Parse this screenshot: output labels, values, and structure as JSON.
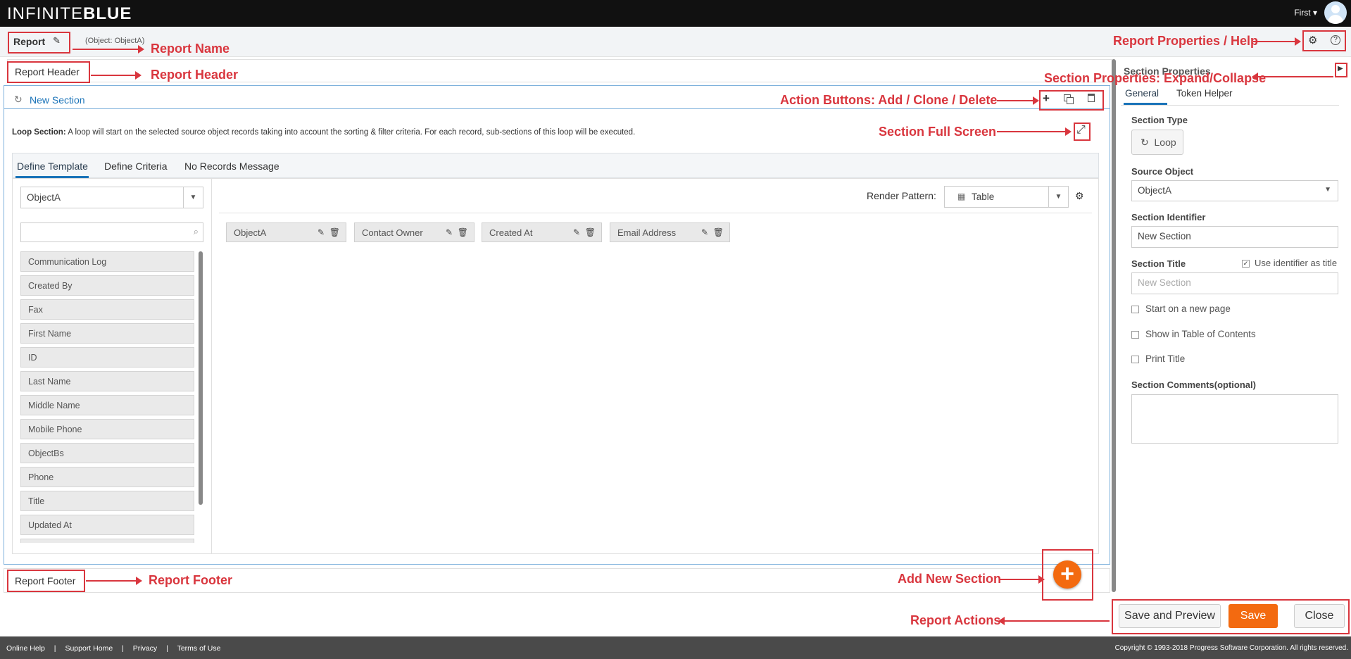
{
  "topbar": {
    "logo_left": "INFINITE",
    "logo_right": "BLUE",
    "user_name": "First ▾"
  },
  "header": {
    "report_title": "Report",
    "object_info": "(Object: ObjectA)"
  },
  "annotations": {
    "report_name": "Report Name",
    "report_header": "Report Header",
    "report_properties_help": "Report Properties / Help",
    "section_properties_expand": "Section Properties: Expand/Collapse",
    "action_buttons": "Action Buttons: Add / Clone / Delete",
    "section_full_screen": "Section Full Screen",
    "add_new_section": "Add New Section",
    "report_footer": "Report Footer",
    "report_actions": "Report Actions"
  },
  "canvas": {
    "report_header_label": "Report Header",
    "section_name": "New Section",
    "loop_prefix": "Loop Section:",
    "loop_description": " A loop will start on the selected source object records taking into account the sorting & filter criteria. For each record, sub-sections of this loop will be executed.",
    "tabs": [
      "Define Template",
      "Define Criteria",
      "No Records Message"
    ],
    "object_select": "ObjectA",
    "search_placeholder": "",
    "fields": [
      "Communication Log",
      "Created By",
      "Fax",
      "First Name",
      "ID",
      "Last Name",
      "Middle Name",
      "Mobile Phone",
      "ObjectBs",
      "Phone",
      "Title",
      "Updated At"
    ],
    "render_pattern_label": "Render Pattern:",
    "render_pattern_value": "Table",
    "columns": [
      "ObjectA",
      "Contact Owner",
      "Created At",
      "Email Address"
    ],
    "report_footer_label": "Report Footer"
  },
  "section_properties": {
    "title": "Section Properties",
    "tabs": [
      "General",
      "Token Helper"
    ],
    "section_type_label": "Section Type",
    "section_type_value": "Loop",
    "source_object_label": "Source Object",
    "source_object_value": "ObjectA",
    "section_identifier_label": "Section Identifier",
    "section_identifier_value": "New Section",
    "section_title_label": "Section Title",
    "use_identifier_label": "Use identifier as title",
    "section_title_placeholder": "New Section",
    "start_new_page_label": "Start on a new page",
    "show_toc_label": "Show in Table of Contents",
    "print_title_label": "Print Title",
    "comments_label": "Section Comments(optional)"
  },
  "actions": {
    "save_preview": "Save and Preview",
    "save": "Save",
    "close": "Close"
  },
  "footer": {
    "links": [
      "Online Help",
      "Support Home",
      "Privacy",
      "Terms of Use"
    ],
    "copyright": "Copyright © 1993-2018 Progress Software Corporation. All rights reserved."
  },
  "colors": {
    "accent": "#1a73b8",
    "save_orange": "#f36a10",
    "annotation_red": "#d9363e"
  }
}
